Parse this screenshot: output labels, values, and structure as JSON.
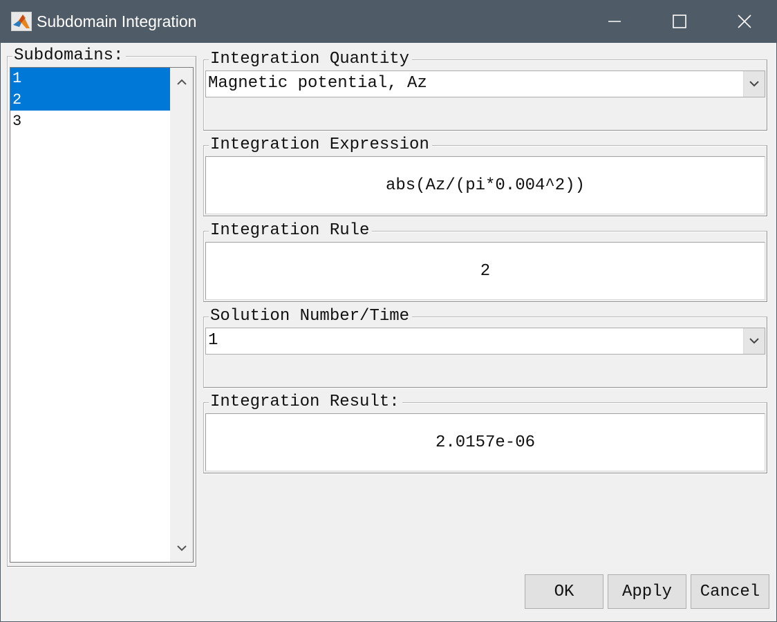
{
  "window": {
    "title": "Subdomain Integration",
    "icons": {
      "app": "matlab-logo-icon",
      "minimize": "minimize-icon",
      "maximize": "maximize-icon",
      "close": "close-icon"
    }
  },
  "subdomains": {
    "label": "Subdomains:",
    "items": [
      {
        "label": "1",
        "selected": true
      },
      {
        "label": "2",
        "selected": true
      },
      {
        "label": "3",
        "selected": false
      }
    ]
  },
  "integration_quantity": {
    "label": "Integration Quantity",
    "value": "Magnetic potential, Az"
  },
  "integration_expression": {
    "label": "Integration Expression",
    "value": "abs(Az/(pi*0.004^2))"
  },
  "integration_rule": {
    "label": "Integration Rule",
    "value": "2"
  },
  "solution_number": {
    "label": "Solution Number/Time",
    "value": "1"
  },
  "integration_result": {
    "label": "Integration Result:",
    "value": "2.0157e-06"
  },
  "buttons": {
    "ok": "OK",
    "apply": "Apply",
    "cancel": "Cancel"
  },
  "colors": {
    "titlebar": "#4f5b67",
    "selection": "#0078d7",
    "background": "#f0f0f0"
  }
}
